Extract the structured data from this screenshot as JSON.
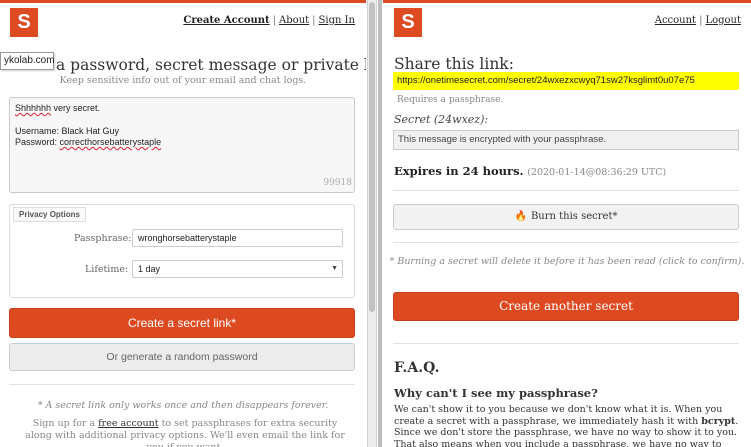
{
  "brand": {
    "logo_letter": "S",
    "accent": "#dd4a22"
  },
  "left": {
    "nav": {
      "create": "Create Account",
      "about": "About",
      "signin": "Sign In",
      "sep": "|"
    },
    "domain_overlay": "ykolab.com",
    "hero_title": "a password, secret message or private link below.",
    "hero_sub": "Keep sensitive info out of your email and chat logs.",
    "secret_lines": [
      "Shhhhhh",
      " very secret.",
      "Username: Black Hat Guy",
      "Password: ",
      "correcthorsebatterystaple"
    ],
    "char_counter": "99918",
    "privacy_legend": "Privacy Options",
    "passphrase_label": "Passphrase:",
    "passphrase_value": "wronghorsebatterystaple",
    "lifetime_label": "Lifetime:",
    "lifetime_value": "1 day",
    "create_link_button": "Create a secret link*",
    "generate_button": "Or generate a random password",
    "note": "* A secret link only works once and then disappears forever.",
    "foot_pre": "Sign up for a ",
    "foot_link": "free account",
    "foot_post": " to set passphrases for extra security along with additional privacy options. We'll even email the link for you if you want."
  },
  "right": {
    "nav": {
      "account": "Account",
      "logout": "Logout",
      "sep": "|"
    },
    "share_title": "Share this link:",
    "share_link": "https://onetimesecret.com/secret/24wxezxcwyq71sw27ksglimt0u07e75",
    "requires": "Requires a passphrase.",
    "secret_label": "Secret (24wxez):",
    "secret_readonly": "This message is encrypted with your passphrase.",
    "expires_label": "Expires in 24 hours.",
    "expires_ts": "(2020-01-14@08:36:29 UTC)",
    "burn_button": "Burn this secret*",
    "burn_note": "* Burning a secret will delete it before it has been read (click to confirm).",
    "create_another": "Create another secret",
    "faq_title": "F.A.Q.",
    "faq_q1": "Why can't I see my passphrase?",
    "faq_a1_pre": "We can't show it to you because we don't know what it is. When you create a secret with a passphrase, we immediately hash it with ",
    "faq_a1_bold": "bcrypt",
    "faq_a1_post": ". Since we don't store the passphrase, we have no way to show it to you. That also means when you include a passphrase, we have no way to decrypt your secret."
  }
}
